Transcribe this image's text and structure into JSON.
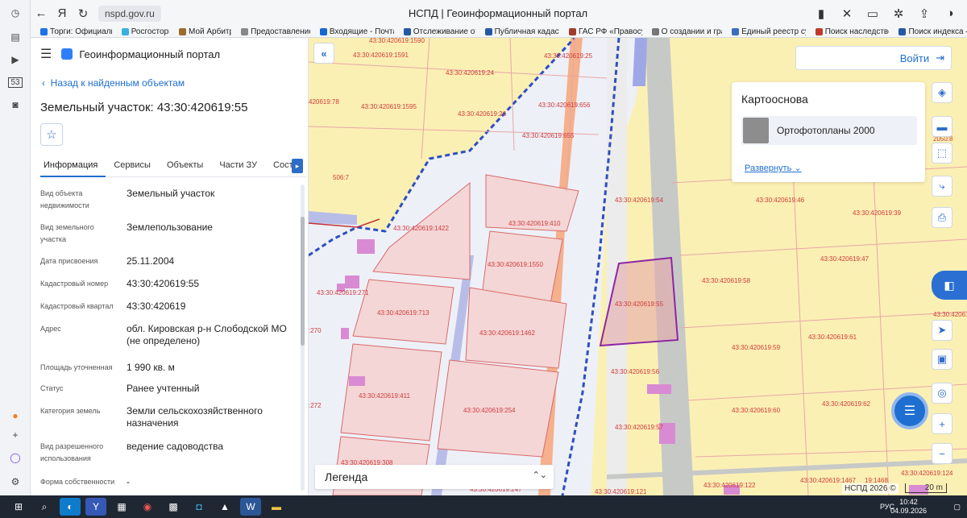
{
  "browser": {
    "url": "nspd.gov.ru",
    "page_title": "НСПД | Геоинформационный портал",
    "bookmarks": [
      {
        "label": "Торги: Официаль",
        "color": "#1a73e8"
      },
      {
        "label": "Росгосторг",
        "color": "#3ab0e2"
      },
      {
        "label": "Мой Арбитр",
        "color": "#9c6b2f"
      },
      {
        "label": "Предоставление",
        "color": "#888888"
      },
      {
        "label": "Входящие - Почта",
        "color": "#1967d2"
      },
      {
        "label": "Отслеживание от",
        "color": "#2458a6"
      },
      {
        "label": "Публичная кадаст",
        "color": "#2458a6"
      },
      {
        "label": "ГАС РФ «Правосу",
        "color": "#a23b2a"
      },
      {
        "label": "О создании и гра",
        "color": "#777777"
      },
      {
        "label": "Единый реестр су",
        "color": "#3b6cc2"
      },
      {
        "label": "Поиск наследстве",
        "color": "#c0392b"
      },
      {
        "label": "Поиск индекса –",
        "color": "#2458a6"
      }
    ]
  },
  "sidebar_badge": "53",
  "panel": {
    "portal_title": "Геоинформационный портал",
    "back_label": "Назад к найденным объектам",
    "object_title": "Земельный участок: 43:30:420619:55",
    "tabs": [
      {
        "label": "Информация",
        "active": true
      },
      {
        "label": "Сервисы",
        "active": false
      },
      {
        "label": "Объекты",
        "active": false
      },
      {
        "label": "Части ЗУ",
        "active": false
      },
      {
        "label": "Состав",
        "active": false
      }
    ],
    "properties": [
      {
        "key": "Вид объекта недвижимости",
        "value": "Земельный участок"
      },
      {
        "key": "Вид земельного участка",
        "value": "Землепользование"
      },
      {
        "key": "Дата присвоения",
        "value": "25.11.2004"
      },
      {
        "key": "Кадастровый номер",
        "value": "43:30:420619:55"
      },
      {
        "key": "Кадастровый квартал",
        "value": "43:30:420619"
      },
      {
        "key": "Адрес",
        "value": "обл. Кировская р-н Слободской МО (не определено)"
      },
      {
        "key": "Площадь уточненная",
        "value": "1 990 кв. м"
      },
      {
        "key": "Статус",
        "value": "Ранее учтенный"
      },
      {
        "key": "Категория земель",
        "value": "Земли сельскохозяйственного назначения"
      },
      {
        "key": "Вид разрешенного использования",
        "value": "ведение садоводства"
      },
      {
        "key": "Форма собственности",
        "value": "-"
      }
    ]
  },
  "map": {
    "login_label": "Войти",
    "basemap_title": "Картооснова",
    "basemap_item": "Ортофотопланы 2000",
    "expand_label": "Развернуть",
    "legend_label": "Легенда",
    "copyright": "НСПД 2026 ©",
    "scale_label": "20 m",
    "parcel_labels": [
      "43:30:420619:1590",
      "43:30:420619:1591",
      "43:30:420619:24",
      "43:30:420619:25",
      "420619:78",
      "43:30:420619:1595",
      "43:30:420619:656",
      "43:30:420619:26",
      "43:30:420619:655",
      "43:30:420619:54",
      "43:30:420619:46",
      "43:30:420619:39",
      "43:30:420619:1422",
      "43:30:420619:410",
      "43:30:420619:1550",
      "43:30:420619:47",
      "43:30:420619:58",
      "43:30:420619:271",
      "43:30:420619:713",
      "43:30:420619:55",
      "43:30:420619:48",
      "43:30:420619:1462",
      "43:30:420619:59",
      "43:30:420619:61",
      "43:30:420619:56",
      "43:30:420619:411",
      "43:30:420619:254",
      "43:30:420619:60",
      "43:30:420619:62",
      "43:30:420619:57",
      "43:30:420619:124",
      "43:30:420619:122",
      "43:30:420619:1467",
      "43:30:420619:121",
      "43:30:420619:247",
      "43:30:420619:308",
      "19:1468",
      ":270",
      ":272",
      "506:7",
      "2050:8"
    ]
  },
  "taskbar": {
    "lang": "РУС",
    "time": "10:42",
    "date": "04.09.2026"
  }
}
